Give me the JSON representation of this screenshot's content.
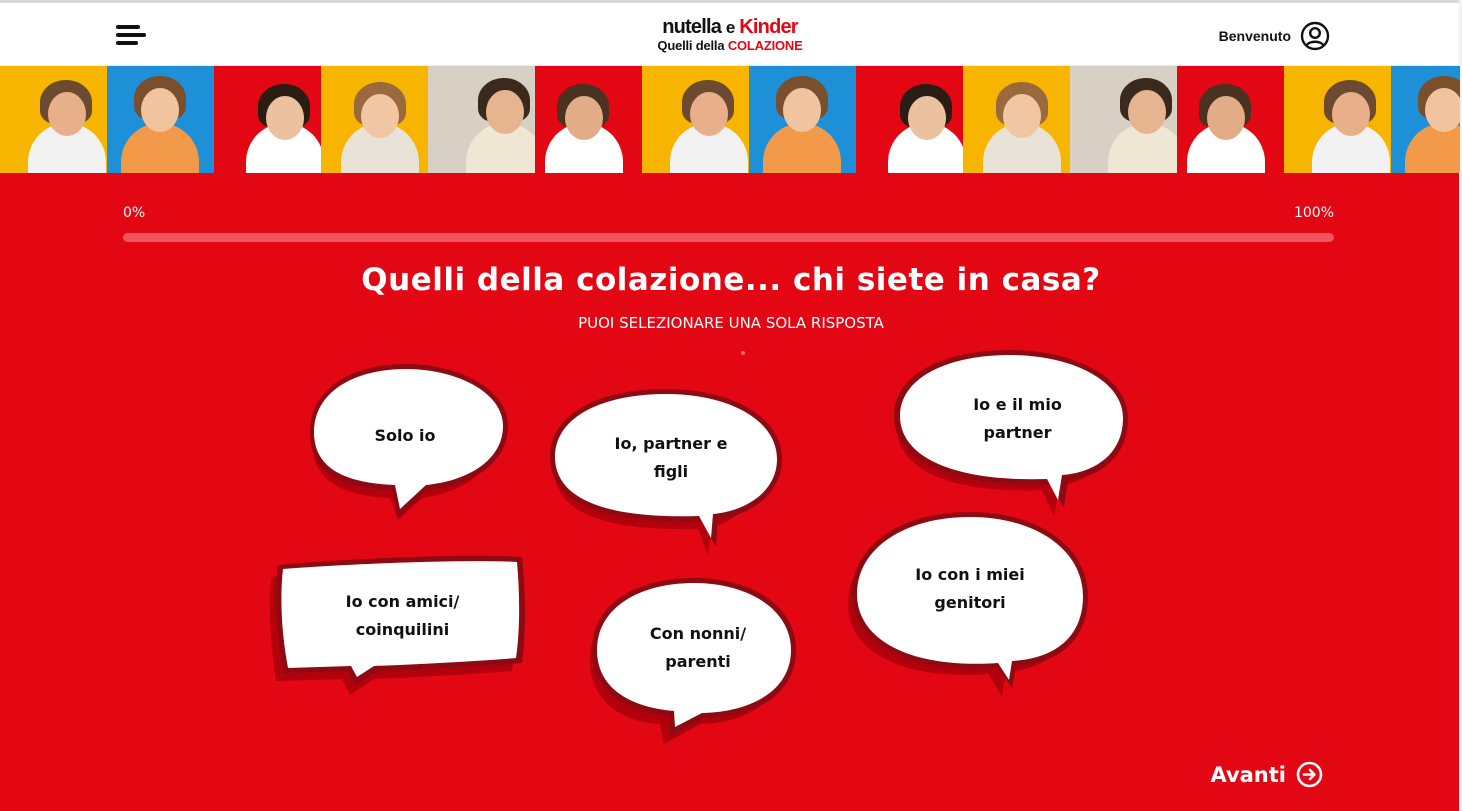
{
  "header": {
    "logo": {
      "line1_nutella": "nutella",
      "line1_e": "e",
      "line1_kinder": "Kinder",
      "line2_prefix": "Quelli della",
      "line2_highlight": "COLAZIONE"
    },
    "welcome_label": "Benvenuto",
    "menu_icon": "hamburger-menu-icon",
    "user_icon": "user-circle-icon"
  },
  "banner": {
    "photos": [
      {
        "bg": "#f7b500",
        "skin": "#e8b08a",
        "hair": "#6b4a2f",
        "shirt": "#f2f2f2"
      },
      {
        "bg": "#1e90d8",
        "skin": "#f0c49f",
        "hair": "#7a4f2d",
        "shirt": "#f29a4a"
      },
      {
        "bg": "#e30613",
        "skin": "#ecc1a0",
        "hair": "#2b1d14",
        "shirt": "#ffffff"
      },
      {
        "bg": "#f7b500",
        "skin": "#f0c7a2",
        "hair": "#9a6a3e",
        "shirt": "#e9e2d6"
      },
      {
        "bg": "#d8d0c4",
        "skin": "#e6b48f",
        "hair": "#3a2a1e",
        "shirt": "#efe6d4"
      },
      {
        "bg": "#e30613",
        "skin": "#e2ad86",
        "hair": "#4a3120",
        "shirt": "#ffffff"
      },
      {
        "bg": "#f7b500",
        "skin": "#e8b08a",
        "hair": "#6b4a2f",
        "shirt": "#f2f2f2"
      },
      {
        "bg": "#1e90d8",
        "skin": "#f0c49f",
        "hair": "#7a4f2d",
        "shirt": "#f29a4a"
      },
      {
        "bg": "#e30613",
        "skin": "#ecc1a0",
        "hair": "#2b1d14",
        "shirt": "#ffffff"
      },
      {
        "bg": "#f7b500",
        "skin": "#f0c7a2",
        "hair": "#9a6a3e",
        "shirt": "#e9e2d6"
      },
      {
        "bg": "#d8d0c4",
        "skin": "#e6b48f",
        "hair": "#3a2a1e",
        "shirt": "#efe6d4"
      },
      {
        "bg": "#e30613",
        "skin": "#e2ad86",
        "hair": "#4a3120",
        "shirt": "#ffffff"
      },
      {
        "bg": "#f7b500",
        "skin": "#e8b08a",
        "hair": "#6b4a2f",
        "shirt": "#f2f2f2"
      },
      {
        "bg": "#1e90d8",
        "skin": "#f0c49f",
        "hair": "#7a4f2d",
        "shirt": "#f29a4a"
      }
    ]
  },
  "progress": {
    "start_label": "0%",
    "end_label": "100%",
    "value": 0
  },
  "question": {
    "title": "Quelli della colazione... chi siete in casa?",
    "subtitle": "PUOI SELEZIONARE UNA SOLA RISPOSTA"
  },
  "answers": [
    {
      "label": "Solo io",
      "shape": "oval"
    },
    {
      "label": "Io, partner e figli",
      "shape": "oval"
    },
    {
      "label": "Io e il mio partner",
      "shape": "oval"
    },
    {
      "label": "Io con amici/ coinquilini",
      "shape": "rect"
    },
    {
      "label": "Con nonni/ parenti",
      "shape": "oval"
    },
    {
      "label": "Io con i miei genitori",
      "shape": "oval"
    }
  ],
  "navigation": {
    "next_label": "Avanti",
    "next_icon": "arrow-right-circle-icon"
  },
  "colors": {
    "background": "#e30613",
    "bubble_fill": "#ffffff",
    "bubble_outline": "#8e0a12",
    "bubble_shadow": "#b3000d"
  }
}
